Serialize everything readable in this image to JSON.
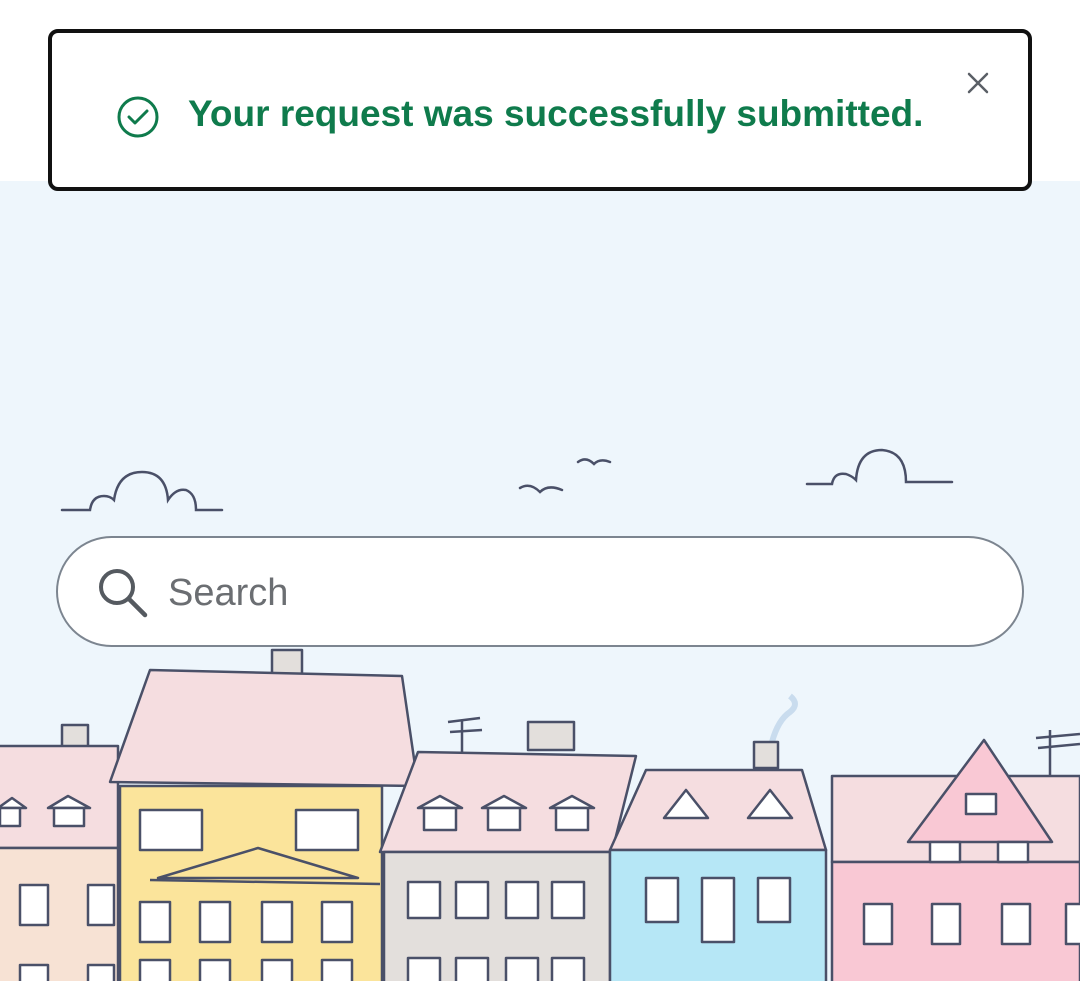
{
  "notification": {
    "message": "Your request was successfully submitted.",
    "status_icon": "check-circle-icon",
    "close_icon": "close-icon",
    "accent_color": "#0f7b4c"
  },
  "search": {
    "placeholder": "Search",
    "value": "",
    "icon": "search-icon"
  },
  "illustration": {
    "name": "town-skyline",
    "colors": {
      "sky": "#eef6fc",
      "roof": "#f5dde0",
      "yellow": "#fbe49b",
      "grey": "#e3dfdc",
      "blue": "#b6e7f6",
      "pink": "#f9c8d4",
      "peach": "#f7e2d4",
      "line": "#4a5068"
    }
  }
}
